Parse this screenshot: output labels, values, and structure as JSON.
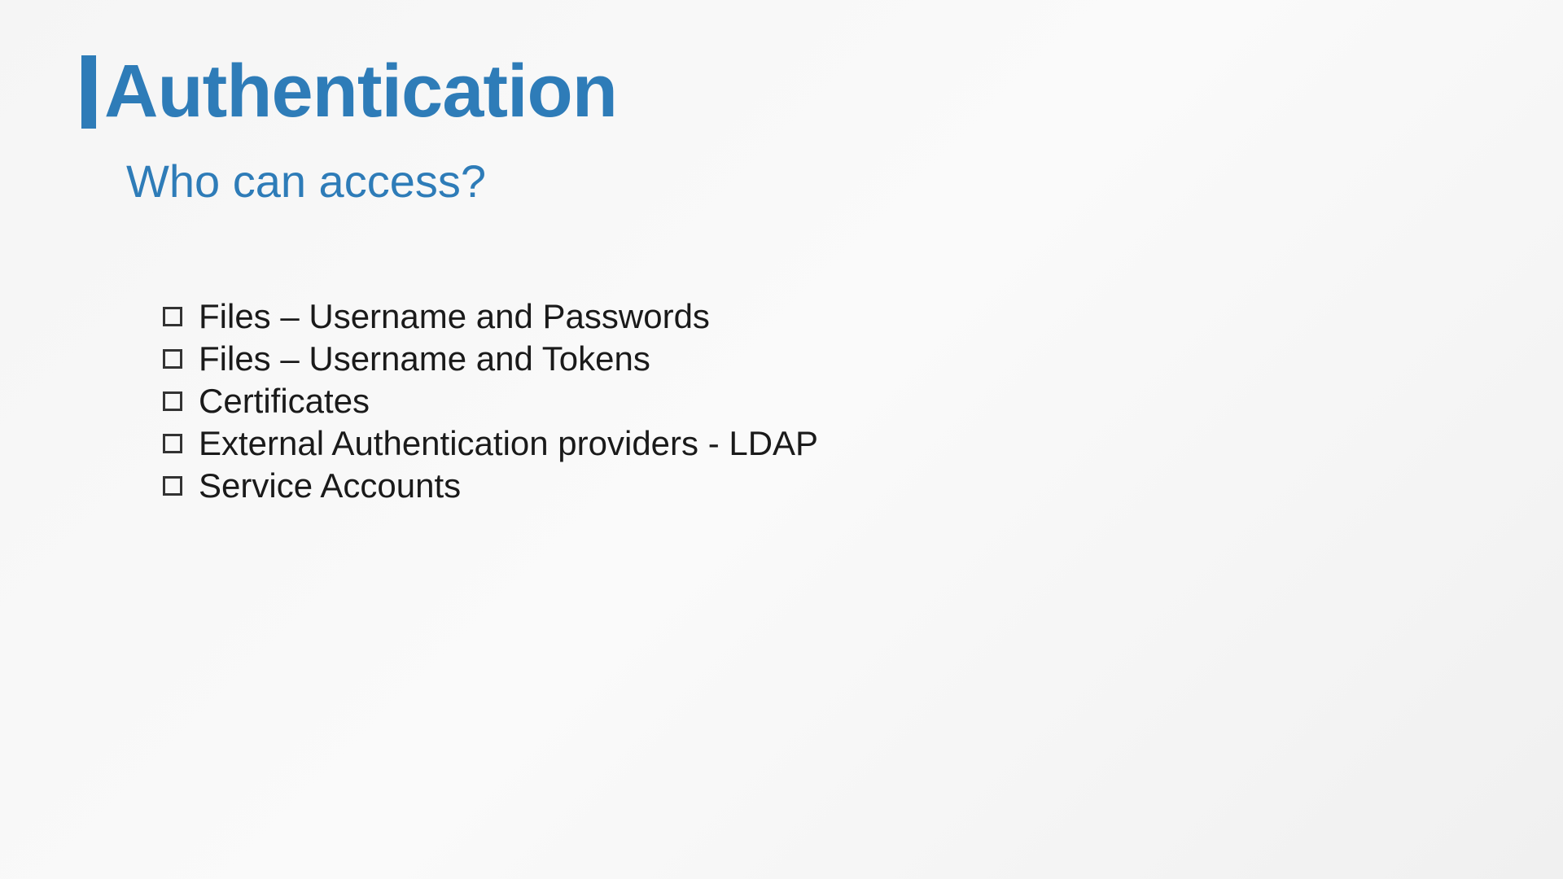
{
  "slide": {
    "title": "Authentication",
    "subtitle": "Who can access?",
    "bullets": [
      "Files – Username and Passwords",
      "Files – Username and Tokens",
      "Certificates",
      "External Authentication providers  - LDAP",
      "Service Accounts"
    ]
  }
}
